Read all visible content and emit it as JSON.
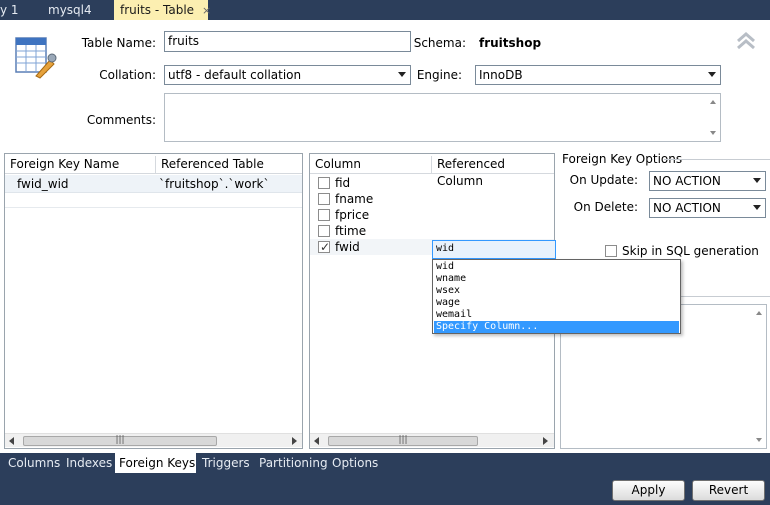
{
  "top_tabs": [
    {
      "label": "y 1"
    },
    {
      "label": "mysql4"
    },
    {
      "label": "fruits - Table",
      "close": "×"
    }
  ],
  "header": {
    "table_name_label": "Table Name:",
    "table_name_value": "fruits",
    "schema_label": "Schema:",
    "schema_value": "fruitshop",
    "collation_label": "Collation:",
    "collation_value": "utf8 - default collation",
    "engine_label": "Engine:",
    "engine_value": "InnoDB",
    "comments_label": "Comments:",
    "comments_value": ""
  },
  "fk_list": {
    "columns": [
      "Foreign Key Name",
      "Referenced Table"
    ],
    "rows": [
      {
        "name": "fwid_wid",
        "ref_table": "`fruitshop`.`work`"
      }
    ]
  },
  "columns_grid": {
    "headers": [
      "Column",
      "Referenced Column"
    ],
    "rows": [
      {
        "name": "fid",
        "checked": false
      },
      {
        "name": "fname",
        "checked": false
      },
      {
        "name": "fprice",
        "checked": false
      },
      {
        "name": "ftime",
        "checked": false
      },
      {
        "name": "fwid",
        "checked": true,
        "ref": "wid"
      }
    ],
    "check_mark": "✓"
  },
  "ref_dropdown": {
    "options": [
      "wid",
      "wname",
      "wsex",
      "wage",
      "wemail",
      "Specify Column..."
    ],
    "selected": "Specify Column..."
  },
  "fk_options": {
    "title": "Foreign Key Options",
    "on_update_label": "On Update:",
    "on_update_value": "NO ACTION",
    "on_delete_label": "On Delete:",
    "on_delete_value": "NO ACTION",
    "skip_label": "Skip in SQL generation"
  },
  "scroll": {
    "grip": "|||"
  },
  "bottom_tabs": [
    {
      "label": "Columns"
    },
    {
      "label": "Indexes"
    },
    {
      "label": "Foreign Keys",
      "active": true
    },
    {
      "label": "Triggers"
    },
    {
      "label": "Partitioning"
    },
    {
      "label": "Options"
    }
  ],
  "buttons": {
    "apply": "Apply",
    "revert": "Revert"
  },
  "colors": {
    "chrome": "#2c3e5b",
    "active_tab": "#fcefb1",
    "selection": "#3399ff"
  }
}
